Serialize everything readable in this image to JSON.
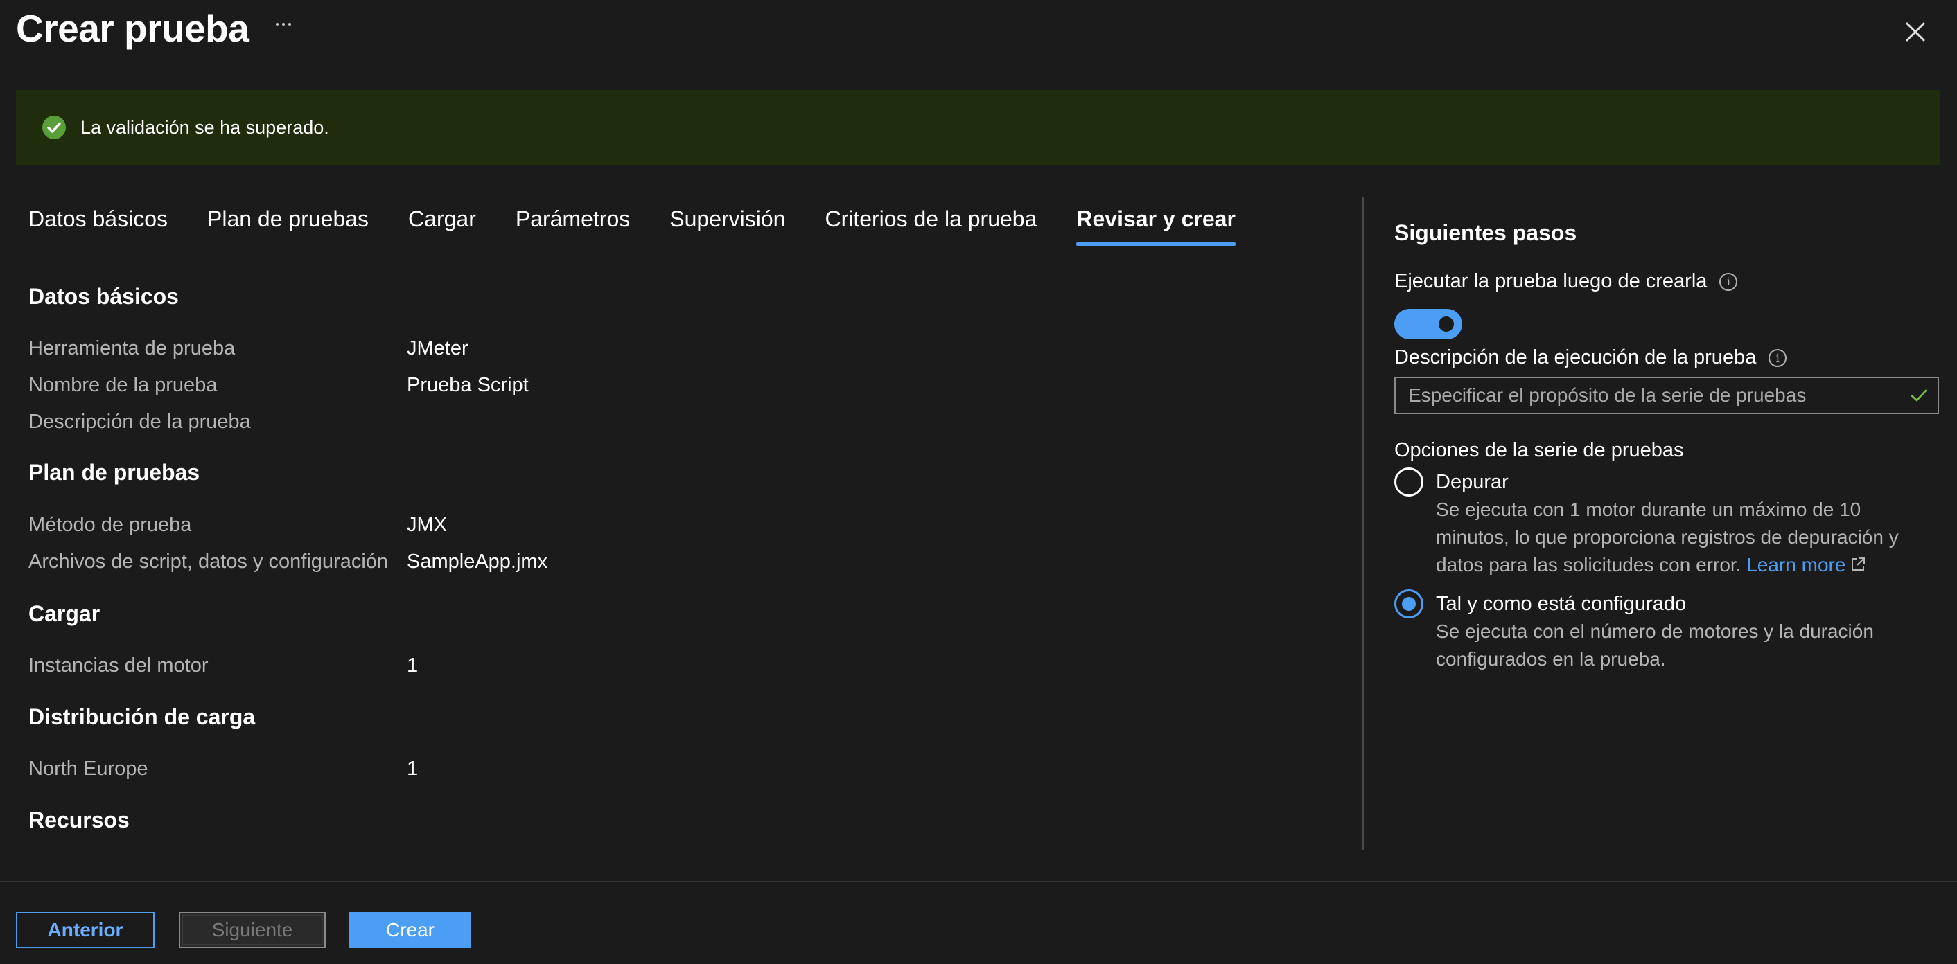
{
  "header": {
    "title": "Crear prueba",
    "more_label": "···"
  },
  "banner": {
    "text": "La validación se ha superado.",
    "status_color": "#5a9e3a"
  },
  "tabs": [
    {
      "label": "Datos básicos",
      "active": false
    },
    {
      "label": "Plan de pruebas",
      "active": false
    },
    {
      "label": "Cargar",
      "active": false
    },
    {
      "label": "Parámetros",
      "active": false
    },
    {
      "label": "Supervisión",
      "active": false
    },
    {
      "label": "Criterios de la prueba",
      "active": false
    },
    {
      "label": "Revisar y crear",
      "active": true
    }
  ],
  "summary": {
    "basics": {
      "heading": "Datos básicos",
      "rows": [
        {
          "label": "Herramienta de prueba",
          "value": "JMeter"
        },
        {
          "label": "Nombre de la prueba",
          "value": "Prueba Script"
        },
        {
          "label": "Descripción de la prueba",
          "value": ""
        }
      ]
    },
    "test_plan": {
      "heading": "Plan de pruebas",
      "rows": [
        {
          "label": "Método de prueba",
          "value": "JMX"
        },
        {
          "label": "Archivos de script, datos y configuración",
          "value": "SampleApp.jmx"
        }
      ]
    },
    "load": {
      "heading": "Cargar",
      "rows": [
        {
          "label": "Instancias del motor",
          "value": "1"
        }
      ]
    },
    "load_distribution": {
      "heading": "Distribución de carga",
      "rows": [
        {
          "label": "North Europe",
          "value": "1"
        }
      ]
    },
    "resources": {
      "heading": "Recursos"
    }
  },
  "next_steps": {
    "title": "Siguientes pasos",
    "run_after_create": {
      "label": "Ejecutar la prueba luego de crearla",
      "enabled": true
    },
    "run_description": {
      "label": "Descripción de la ejecución de la prueba",
      "value": "",
      "placeholder": "Especificar el propósito de la serie de pruebas"
    },
    "run_options": {
      "label": "Opciones de la serie de pruebas",
      "debug": {
        "label": "Depurar",
        "description": "Se ejecuta con 1 motor durante un máximo de 10 minutos, lo que proporciona registros de depuración y datos para las solicitudes con error.",
        "link": "Learn more",
        "selected": false
      },
      "as_configured": {
        "label": "Tal y como está configurado",
        "description": "Se ejecuta con el número de motores y la duración configurados en la prueba.",
        "selected": true
      }
    }
  },
  "footer": {
    "previous": "Anterior",
    "next": "Siguiente",
    "create": "Crear"
  },
  "colors": {
    "accent": "#4c9ef5",
    "banner_bg": "#1f2d0d",
    "background": "#1b1b1b"
  }
}
